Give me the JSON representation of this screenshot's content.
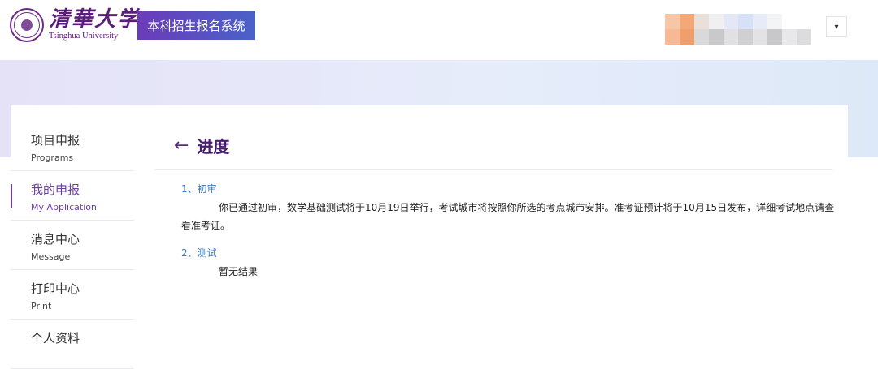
{
  "header": {
    "logo_cn": "清華大学",
    "logo_en": "Tsinghua University",
    "system_title": "本科招生报名系统",
    "user_menu_caret": "▾"
  },
  "sidebar": {
    "items": [
      {
        "cn": "项目申报",
        "en": "Programs",
        "active": false
      },
      {
        "cn": "我的申报",
        "en": "My Application",
        "active": true
      },
      {
        "cn": "消息中心",
        "en": "Message",
        "active": false
      },
      {
        "cn": "打印中心",
        "en": "Print",
        "active": false
      },
      {
        "cn": "个人资料",
        "en": "",
        "active": false
      }
    ]
  },
  "main": {
    "back_icon": "←",
    "title": "进度",
    "sections": [
      {
        "title": "1、初审",
        "body": "你已通过初审，数学基础测试将于10月19日举行，考试城市将按照你所选的考点城市安排。准考证预计将于10月15日发布，详细考试地点请查看准考证。"
      },
      {
        "title": "2、测试",
        "body": "暂无结果"
      }
    ]
  },
  "colors": {
    "brand_purple": "#5a1f78",
    "accent_blue": "#3a78c8",
    "banner_from": "#e5e2f7",
    "banner_to": "#dde9f8"
  }
}
